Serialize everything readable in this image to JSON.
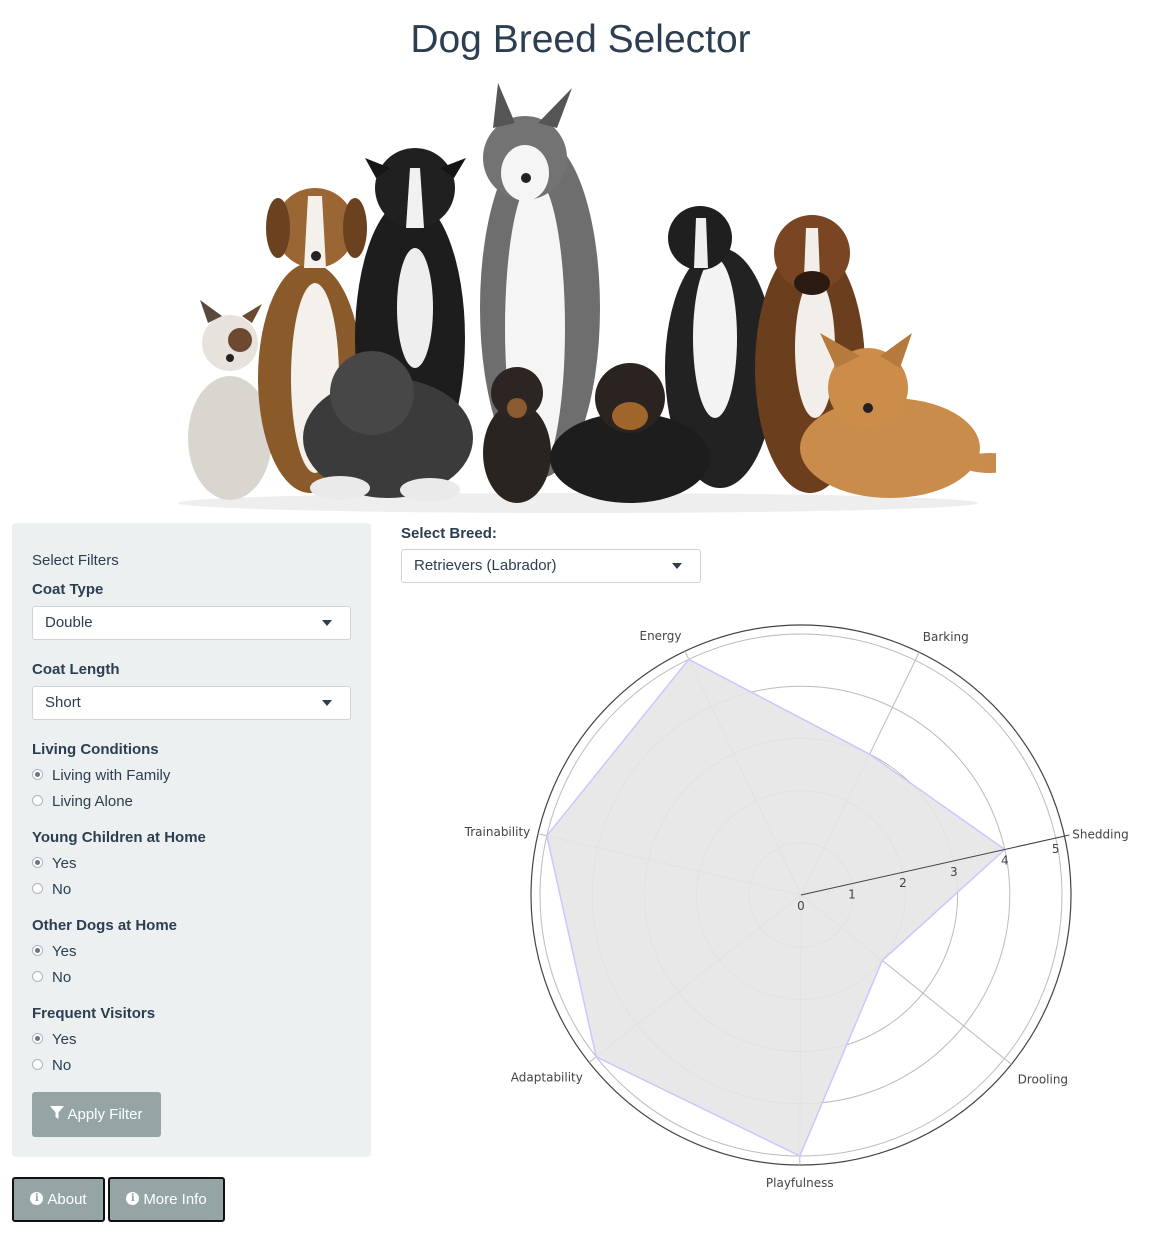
{
  "page": {
    "title": "Dog Breed Selector"
  },
  "filters": {
    "heading": "Select Filters",
    "coat_type": {
      "label": "Coat Type",
      "value": "Double"
    },
    "coat_length": {
      "label": "Coat Length",
      "value": "Short"
    },
    "living_conditions": {
      "label": "Living Conditions",
      "options": [
        "Living with Family",
        "Living Alone"
      ],
      "selected": 0
    },
    "young_children": {
      "label": "Young Children at Home",
      "options": [
        "Yes",
        "No"
      ],
      "selected": 0
    },
    "other_dogs": {
      "label": "Other Dogs at Home",
      "options": [
        "Yes",
        "No"
      ],
      "selected": 0
    },
    "frequent_visitors": {
      "label": "Frequent Visitors",
      "options": [
        "Yes",
        "No"
      ],
      "selected": 0
    },
    "apply_label": "Apply Filter"
  },
  "footer": {
    "about_label": "About",
    "more_info_label": "More Info"
  },
  "breed": {
    "label": "Select Breed:",
    "value": "Retrievers (Labrador)"
  },
  "chart_data": {
    "type": "radar",
    "axes": [
      "Shedding",
      "Drooling",
      "Playfulness",
      "Adaptability",
      "Trainability",
      "Energy",
      "Barking"
    ],
    "series": [
      {
        "values": [
          4,
          2,
          5,
          5,
          5,
          5,
          3
        ]
      }
    ],
    "radial_range": [
      0,
      5
    ],
    "radial_ticks": [
      "0",
      "1",
      "2",
      "3",
      "4",
      "5"
    ],
    "fill_color": "#e5e5e5",
    "line_color": "#c8c8ff"
  }
}
